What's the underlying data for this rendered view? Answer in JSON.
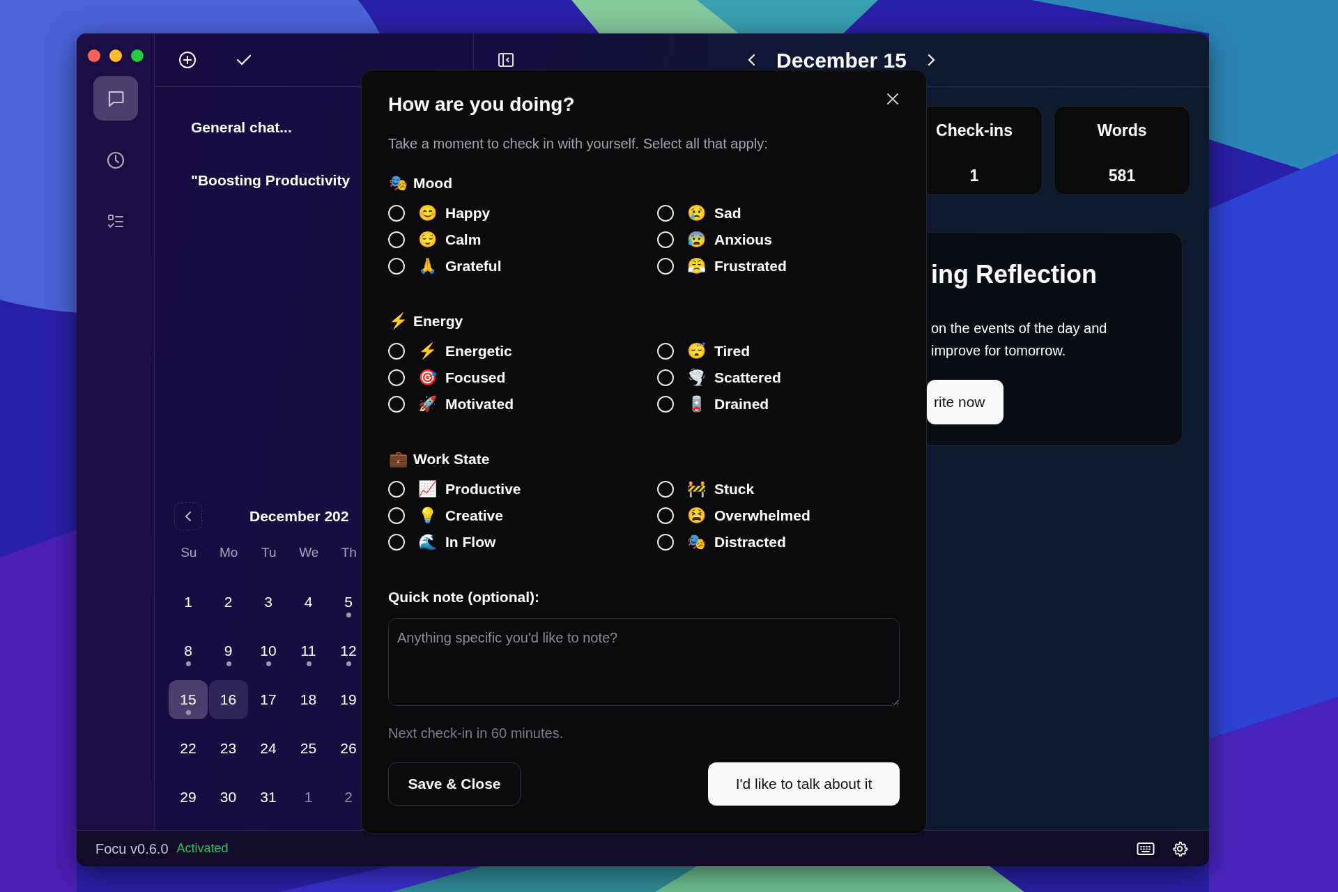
{
  "rail": {
    "items": [
      {
        "kind": "chat",
        "selected": true
      },
      {
        "kind": "history",
        "selected": false
      },
      {
        "kind": "tasks",
        "selected": false
      }
    ]
  },
  "chat_list": {
    "items": [
      {
        "title": "General chat..."
      },
      {
        "title": "\"Boosting Productivity"
      }
    ]
  },
  "calendar": {
    "month": "December 202",
    "weekdays": [
      "Su",
      "Mo",
      "Tu",
      "We",
      "Th"
    ],
    "weeks": [
      [
        {
          "day": "1",
          "dot": false,
          "selected": false,
          "today": false,
          "muted": false
        },
        {
          "day": "2",
          "dot": false,
          "selected": false,
          "today": false,
          "muted": false
        },
        {
          "day": "3",
          "dot": false,
          "selected": false,
          "today": false,
          "muted": false
        },
        {
          "day": "4",
          "dot": false,
          "selected": false,
          "today": false,
          "muted": false
        },
        {
          "day": "5",
          "dot": true,
          "selected": false,
          "today": false,
          "muted": false
        }
      ],
      [
        {
          "day": "8",
          "dot": true,
          "selected": false,
          "today": false,
          "muted": false
        },
        {
          "day": "9",
          "dot": true,
          "selected": false,
          "today": false,
          "muted": false
        },
        {
          "day": "10",
          "dot": true,
          "selected": false,
          "today": false,
          "muted": false
        },
        {
          "day": "11",
          "dot": true,
          "selected": false,
          "today": false,
          "muted": false
        },
        {
          "day": "12",
          "dot": true,
          "selected": false,
          "today": false,
          "muted": false
        }
      ],
      [
        {
          "day": "15",
          "dot": true,
          "selected": true,
          "today": false,
          "muted": false
        },
        {
          "day": "16",
          "dot": false,
          "selected": false,
          "today": true,
          "muted": false
        },
        {
          "day": "17",
          "dot": false,
          "selected": false,
          "today": false,
          "muted": false
        },
        {
          "day": "18",
          "dot": false,
          "selected": false,
          "today": false,
          "muted": false
        },
        {
          "day": "19",
          "dot": false,
          "selected": false,
          "today": false,
          "muted": false
        }
      ],
      [
        {
          "day": "22",
          "dot": false,
          "selected": false,
          "today": false,
          "muted": false
        },
        {
          "day": "23",
          "dot": false,
          "selected": false,
          "today": false,
          "muted": false
        },
        {
          "day": "24",
          "dot": false,
          "selected": false,
          "today": false,
          "muted": false
        },
        {
          "day": "25",
          "dot": false,
          "selected": false,
          "today": false,
          "muted": false
        },
        {
          "day": "26",
          "dot": false,
          "selected": false,
          "today": false,
          "muted": false
        }
      ],
      [
        {
          "day": "29",
          "dot": false,
          "selected": false,
          "today": false,
          "muted": false
        },
        {
          "day": "30",
          "dot": false,
          "selected": false,
          "today": false,
          "muted": false
        },
        {
          "day": "31",
          "dot": false,
          "selected": false,
          "today": false,
          "muted": false
        },
        {
          "day": "1",
          "dot": false,
          "selected": false,
          "today": false,
          "muted": true
        },
        {
          "day": "2",
          "dot": false,
          "selected": false,
          "today": false,
          "muted": true
        }
      ]
    ]
  },
  "header": {
    "date": "December 15"
  },
  "stats": [
    {
      "label": "Check-ins",
      "value": "1"
    },
    {
      "label": "Words",
      "value": "581"
    }
  ],
  "reflection": {
    "title": "ing Reflection",
    "lines": [
      "on the events of the day and",
      "improve for tomorrow."
    ],
    "button": "rite now"
  },
  "dialog": {
    "title": "How are you doing?",
    "subtitle": "Take a moment to check in with yourself. Select all that apply:",
    "sections": [
      {
        "icon": "🎭",
        "title": "Mood",
        "options": [
          {
            "icon": "😊",
            "label": "Happy",
            "checked": false
          },
          {
            "icon": "😌",
            "label": "Calm",
            "checked": false
          },
          {
            "icon": "🙏",
            "label": "Grateful",
            "checked": false
          },
          {
            "icon": "😢",
            "label": "Sad",
            "checked": false
          },
          {
            "icon": "😰",
            "label": "Anxious",
            "checked": false
          },
          {
            "icon": "😤",
            "label": "Frustrated",
            "checked": false
          }
        ]
      },
      {
        "icon": "⚡",
        "title": "Energy",
        "options": [
          {
            "icon": "⚡",
            "label": "Energetic",
            "checked": false
          },
          {
            "icon": "🎯",
            "label": "Focused",
            "checked": false
          },
          {
            "icon": "🚀",
            "label": "Motivated",
            "checked": false
          },
          {
            "icon": "😴",
            "label": "Tired",
            "checked": false
          },
          {
            "icon": "🌪️",
            "label": "Scattered",
            "checked": false
          },
          {
            "icon": "🪫",
            "label": "Drained",
            "checked": false
          }
        ]
      },
      {
        "icon": "💼",
        "title": "Work State",
        "options": [
          {
            "icon": "📈",
            "label": "Productive",
            "checked": false
          },
          {
            "icon": "💡",
            "label": "Creative",
            "checked": false
          },
          {
            "icon": "🌊",
            "label": "In Flow",
            "checked": false
          },
          {
            "icon": "🚧",
            "label": "Stuck",
            "checked": false
          },
          {
            "icon": "😫",
            "label": "Overwhelmed",
            "checked": false
          },
          {
            "icon": "🎭",
            "label": "Distracted",
            "checked": false
          }
        ]
      }
    ],
    "note_label": "Quick note (optional):",
    "note": {
      "placeholder": "Anything specific you'd like to note?"
    },
    "next_checkin": "Next check-in in 60 minutes.",
    "buttons": [
      {
        "label": "Save & Close",
        "kind": "secondary"
      },
      {
        "label": "I'd like to talk about it",
        "kind": "primary"
      }
    ]
  },
  "status_bar": {
    "app": "Focu v0.6.0",
    "license": "Activated"
  }
}
